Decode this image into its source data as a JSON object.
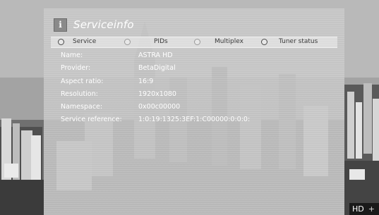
{
  "window": {
    "title": "Serviceinfo"
  },
  "icon": {
    "name": "info-icon",
    "glyph": "i"
  },
  "tabs": [
    {
      "label": "Service",
      "selected": true
    },
    {
      "label": "PIDs",
      "selected": false
    },
    {
      "label": "Multiplex",
      "selected": false
    },
    {
      "label": "Tuner status",
      "selected": true
    }
  ],
  "info": [
    {
      "key": "Name:",
      "value": "ASTRA HD"
    },
    {
      "key": "Provider:",
      "value": "BetaDigital"
    },
    {
      "key": "Aspect ratio:",
      "value": "16:9"
    },
    {
      "key": "Resolution:",
      "value": "1920x1080"
    },
    {
      "key": "Namespace:",
      "value": "0x00c00000"
    },
    {
      "key": "Service reference:",
      "value": "1:0:19:1325:3EF:1:C00000:0:0:0:"
    }
  ],
  "corner_badge": {
    "label": "HD",
    "extra": "+"
  }
}
